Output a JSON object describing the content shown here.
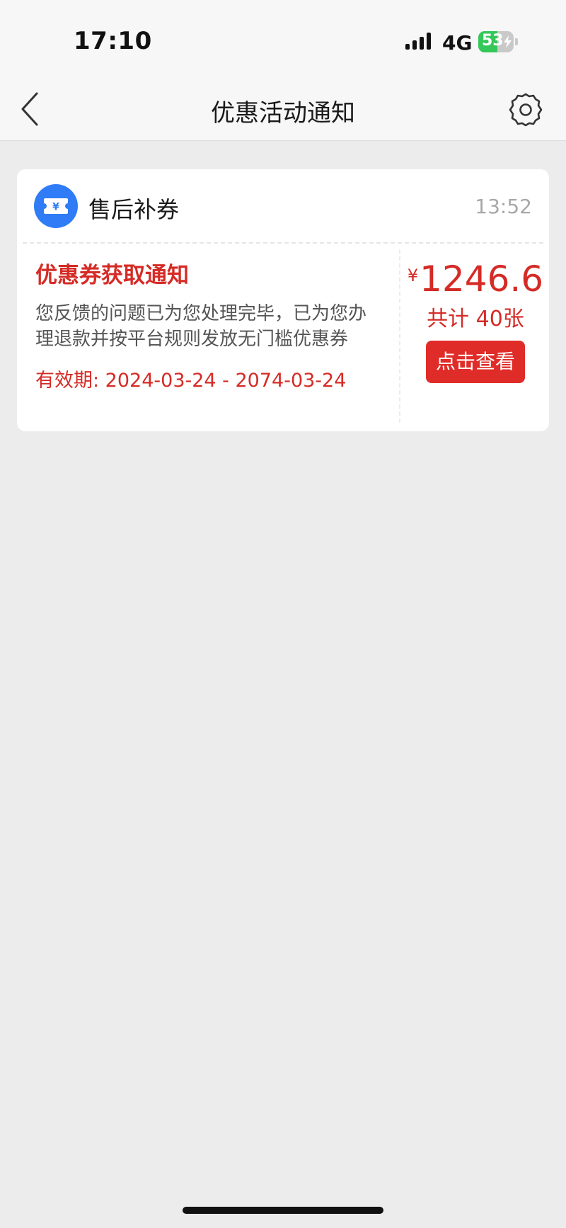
{
  "status_bar": {
    "time": "17:10",
    "network": "4G",
    "battery_level": "53",
    "battery_fraction": 0.53,
    "icons": [
      "signal-icon",
      "battery-icon",
      "charging-bolt-icon"
    ]
  },
  "nav": {
    "title": "优惠活动通知",
    "back_icon": "chevron-left-icon",
    "settings_icon": "gear-icon"
  },
  "card": {
    "category_icon": "ticket-icon",
    "category_icon_glyph": "¥",
    "category_title": "售后补券",
    "time": "13:52",
    "notice_title": "优惠券获取通知",
    "description": "您反馈的问题已为您处理完毕，已为您办理退款并按平台规则发放无门槛优惠券",
    "validity": "有效期: 2024-03-24 - 2074-03-24",
    "amount_currency": "¥",
    "amount": "1246.6",
    "count_label": "共计 40张",
    "view_button": "点击查看"
  },
  "colors": {
    "accent_red": "#d52b26",
    "button_red": "#e02c28",
    "icon_blue": "#2f7cf6",
    "battery_green": "#34c759",
    "background": "#ececec"
  }
}
